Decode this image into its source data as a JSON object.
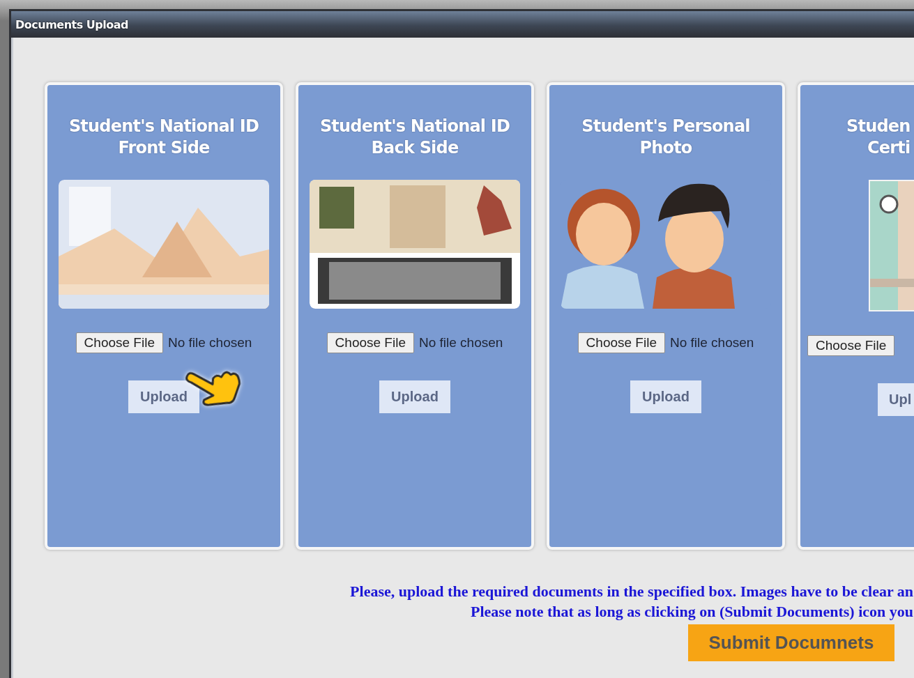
{
  "window": {
    "title": "Documents Upload"
  },
  "cards": [
    {
      "kind": "full",
      "title": [
        "Student's National ID",
        "Front Side"
      ],
      "file_button": "Choose File",
      "file_status": "No file chosen",
      "upload_button": "Upload"
    },
    {
      "kind": "full",
      "title": [
        "Student's National ID",
        "Back Side"
      ],
      "file_button": "Choose File",
      "file_status": "No file chosen",
      "upload_button": "Upload"
    },
    {
      "kind": "full",
      "title": [
        "Student's Personal",
        "Photo"
      ],
      "file_button": "Choose File",
      "file_status": "No file chosen",
      "upload_button": "Upload"
    },
    {
      "kind": "partial",
      "title": [
        "Studen",
        "Certi"
      ],
      "file_button": "Choose File",
      "upload_button": "Upl"
    }
  ],
  "notes": [
    "Please, upload the required documents in the specified box. Images have to be clear an",
    "Please note that as long as clicking on (Submit Documents) icon you"
  ],
  "submit_button": "Submit Documnets"
}
